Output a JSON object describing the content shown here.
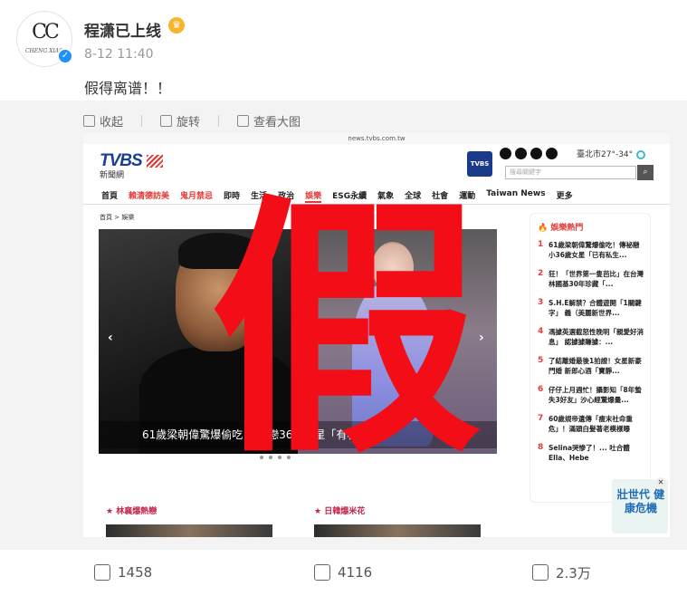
{
  "post": {
    "username": "程潇已上线",
    "avatar_mark": "CC",
    "avatar_sub": "CHENG XIAO",
    "time": "8-12 11:40",
    "text": "假得离谱！！"
  },
  "media_toolbar": {
    "collapse": "收起",
    "rotate": "旋转",
    "view_large": "查看大图"
  },
  "screenshot": {
    "url": "news.tvbs.com.tw",
    "logo": "TVBS",
    "logo_sub": "新聞網",
    "badge": "TVBS",
    "weather": "臺北市27°-34°",
    "search_placeholder": "搜尋關鍵字",
    "search_button_icon": "search-icon",
    "nav": [
      "首頁",
      "賴清德訪美",
      "鬼月禁忌",
      "即時",
      "生活",
      "政治",
      "娛樂",
      "ESG永續",
      "氣象",
      "全球",
      "社會",
      "運動",
      "Taiwan News",
      "更多"
    ],
    "breadcrumb": "首頁 > 娛樂",
    "caption": "61歲梁朝偉驚爆偷吃  傳祕戀36歲女星「有私生子」",
    "hot_title": "娛樂熱門",
    "hot_items": [
      {
        "num": "1",
        "text": "61歲梁朝偉驚爆偷吃！傳祕戀小36歲女星「已有私生..."
      },
      {
        "num": "2",
        "text": "狂！「世界第一隻芭比」在台灣  林國基30年珍藏「..."
      },
      {
        "num": "3",
        "text": "S.H.E解禁？合體遊開「1關鍵字」  義（美麗新世界..."
      },
      {
        "num": "4",
        "text": "馮據英選截怒性晚明「親愛好消息」  認據據賺據：..."
      },
      {
        "num": "5",
        "text": "了結離婚最後1拍證！女星新豪門婚  新郎心酒「寶靜..."
      },
      {
        "num": "6",
        "text": "仔仔上月週忙！攝影知「8年蟄失3好友」沙心經驚爆量..."
      },
      {
        "num": "7",
        "text": "60歲規帝遺傳「瘦末社命重危」！滿頭白髮著老模樣曝"
      },
      {
        "num": "8",
        "text": "Selina哭惨了！...  吐合體Ella、Hebe"
      }
    ],
    "card_left": "林襄爆熱戀",
    "card_right": "日韓爆米花",
    "ad_text": "壯世代 健康危機",
    "fake_stamp": "假"
  },
  "actions": {
    "share_count": "1458",
    "comment_count": "4116",
    "like_count": "2.3万"
  }
}
